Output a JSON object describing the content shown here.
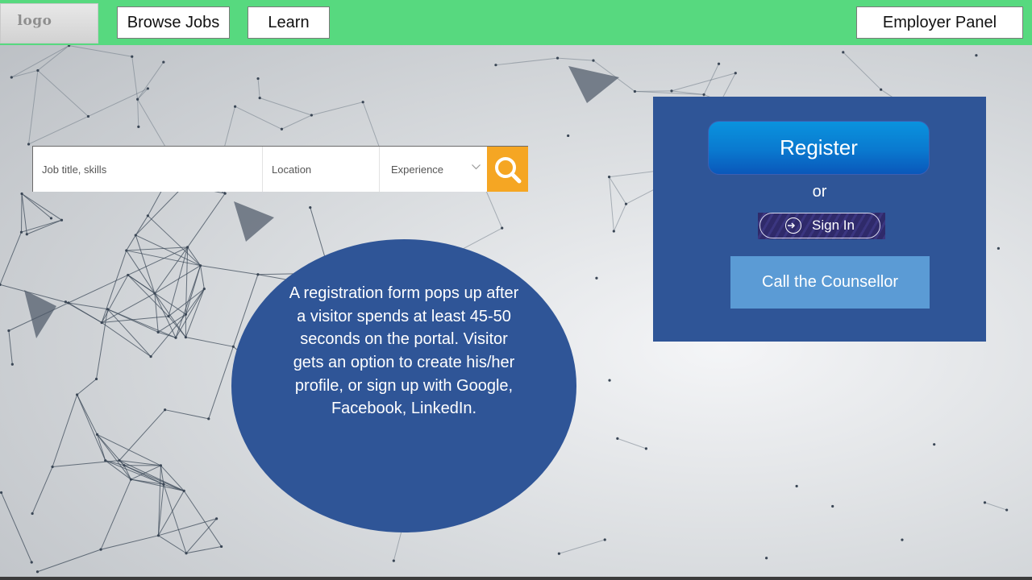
{
  "header": {
    "logo_text": "logo",
    "nav": {
      "browse_jobs": "Browse Jobs",
      "learn": "Learn",
      "employer_panel": "Employer Panel"
    }
  },
  "search": {
    "job_placeholder": "Job title, skills",
    "location_placeholder": "Location",
    "experience_label": "Experience",
    "button_icon": "search-icon"
  },
  "note": {
    "text": "A registration form pops up after a visitor spends at least 45-50 seconds on the portal. Visitor gets an option to create his/her profile, or sign up with Google, Facebook, LinkedIn."
  },
  "panel": {
    "register_label": "Register",
    "or_text": "or",
    "signin_label": "Sign In",
    "signin_icon": "sign-in-icon",
    "counsellor_label": "Call the Counsellor"
  },
  "colors": {
    "header_green": "#57d97f",
    "panel_blue": "#2f5597",
    "search_orange": "#f5a623",
    "counsellor_blue": "#5b9bd5"
  }
}
